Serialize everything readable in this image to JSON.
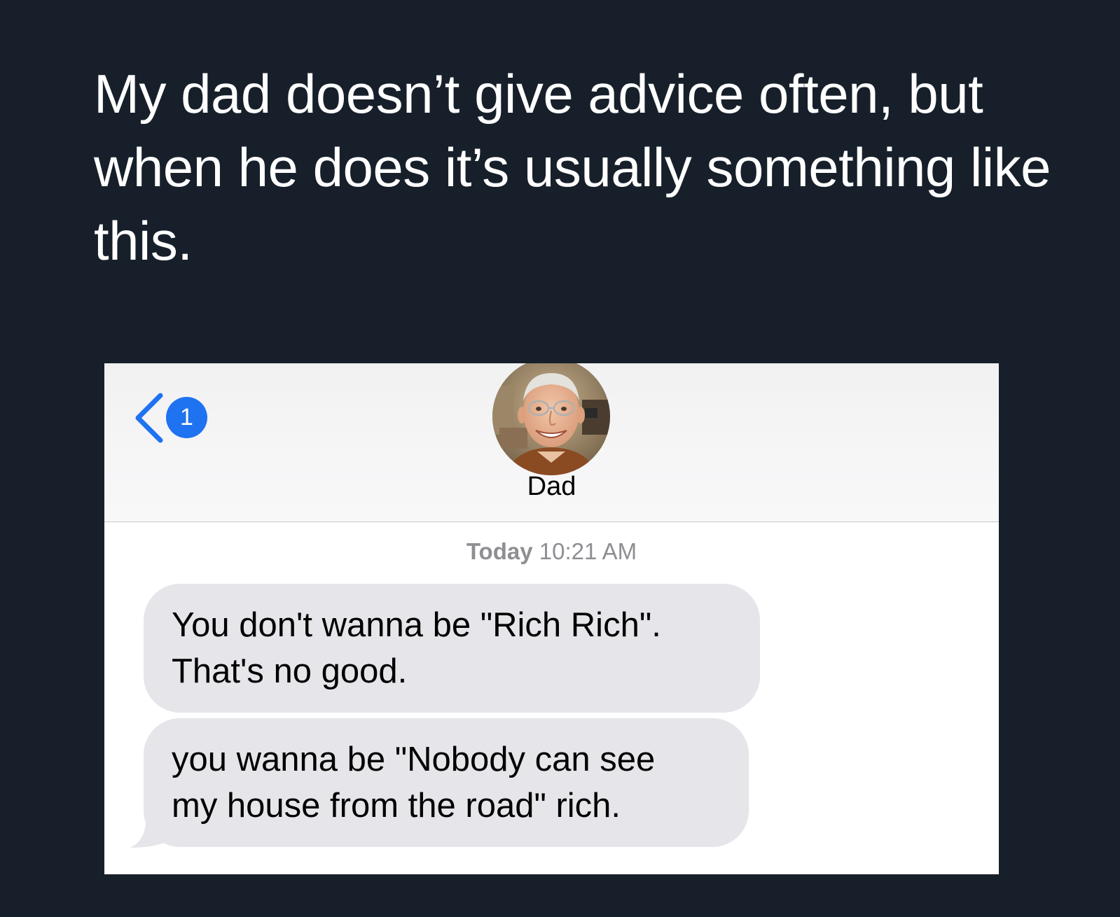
{
  "post": {
    "text": "My dad doesn’t give advice often, but when he does it’s usually something like this."
  },
  "header": {
    "unread_count": "1",
    "contact_name": "Dad"
  },
  "conversation": {
    "timestamp_day": "Today",
    "timestamp_time": "10:21 AM",
    "messages": [
      {
        "lines": [
          "You don't wanna be \"Rich Rich\".",
          "That's no good."
        ]
      },
      {
        "lines": [
          "you wanna be \"Nobody can see",
          "my house from the road\" rich."
        ]
      }
    ]
  },
  "colors": {
    "page_background": "#17202a",
    "accent": "#1f72f0",
    "incoming_bubble": "#e5e5ea",
    "timestamp": "#8e8e93"
  },
  "icons": {
    "back": "chevron-left-icon",
    "avatar": "contact-photo"
  }
}
